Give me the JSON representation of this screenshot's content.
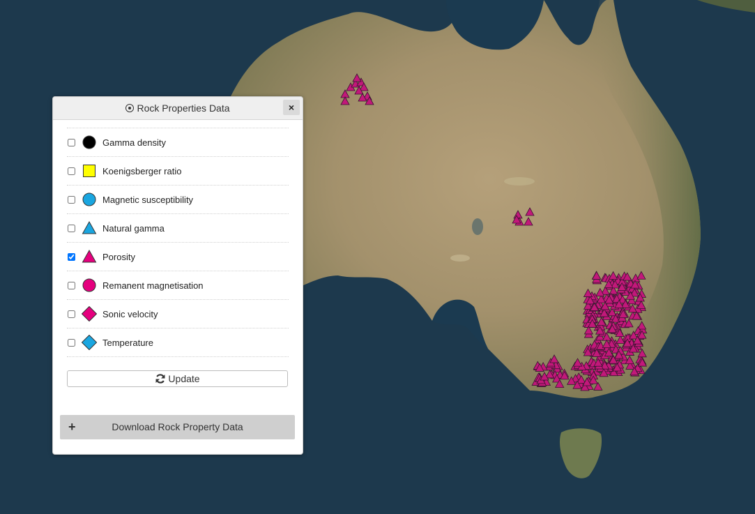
{
  "panel": {
    "title": "Rock Properties Data",
    "close_label": "×",
    "update_label": "Update",
    "download_label": "Download Rock Property Data",
    "layers": [
      {
        "label": "Gamma density",
        "checked": false,
        "shape": "circle",
        "color": "#000000",
        "icon": "black-circle-icon"
      },
      {
        "label": "Koenigsberger ratio",
        "checked": false,
        "shape": "square",
        "color": "#ffff00",
        "icon": "yellow-square-icon"
      },
      {
        "label": "Magnetic susceptibility",
        "checked": false,
        "shape": "circle",
        "color": "#1aa6e0",
        "icon": "blue-circle-icon"
      },
      {
        "label": "Natural gamma",
        "checked": false,
        "shape": "triangle",
        "color": "#1aa6e0",
        "icon": "blue-triangle-icon"
      },
      {
        "label": "Porosity",
        "checked": true,
        "shape": "triangle",
        "color": "#e5007e",
        "icon": "magenta-triangle-icon"
      },
      {
        "label": "Remanent magnetisation",
        "checked": false,
        "shape": "circle",
        "color": "#e5007e",
        "icon": "magenta-circle-icon"
      },
      {
        "label": "Sonic velocity",
        "checked": false,
        "shape": "diamond",
        "color": "#e5007e",
        "icon": "magenta-diamond-icon"
      },
      {
        "label": "Temperature",
        "checked": false,
        "shape": "diamond",
        "color": "#1aa6e0",
        "icon": "blue-diamond-icon"
      }
    ]
  },
  "map": {
    "ocean_color": "#1b3346",
    "land_color": "#a89672",
    "marker_color": "#c2187a"
  }
}
